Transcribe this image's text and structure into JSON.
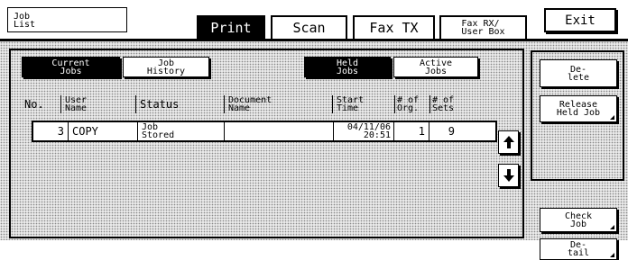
{
  "header": {
    "title": "Job\nList",
    "tabs": [
      {
        "label": "Print",
        "active": true
      },
      {
        "label": "Scan",
        "active": false
      },
      {
        "label": "Fax TX",
        "active": false
      },
      {
        "label": "Fax RX/\nUser Box",
        "active": false
      }
    ],
    "exit_label": "Exit"
  },
  "view_toggle": {
    "current_jobs": "Current\nJobs",
    "job_history": "Job\nHistory"
  },
  "job_filter": {
    "held_jobs": "Held\nJobs",
    "active_jobs": "Active\nJobs"
  },
  "table": {
    "columns": {
      "no": "No.",
      "user_name": "User\nName",
      "status": "Status",
      "document_name": "Document\nName",
      "start_time": "Start\nTime",
      "num_orig": "# of\nOrg.",
      "num_sets": "# of\nSets"
    },
    "rows": [
      {
        "no": "3",
        "user_name": "COPY",
        "status": "Job\nStored",
        "document_name": "",
        "start_time": "04/11/06\n20:51",
        "num_orig": "1",
        "num_sets": "9"
      }
    ]
  },
  "side_actions": {
    "delete": "De-\nlete",
    "release": "Release\nHeld Job",
    "check_job": "Check\nJob",
    "detail": "De-\ntail"
  },
  "icons": {
    "scroll_up": "arrow-up-icon",
    "scroll_down": "arrow-down-icon"
  },
  "colors": {
    "active": "#000000",
    "background": "#ffffff",
    "texture": "#e9e9e9"
  }
}
